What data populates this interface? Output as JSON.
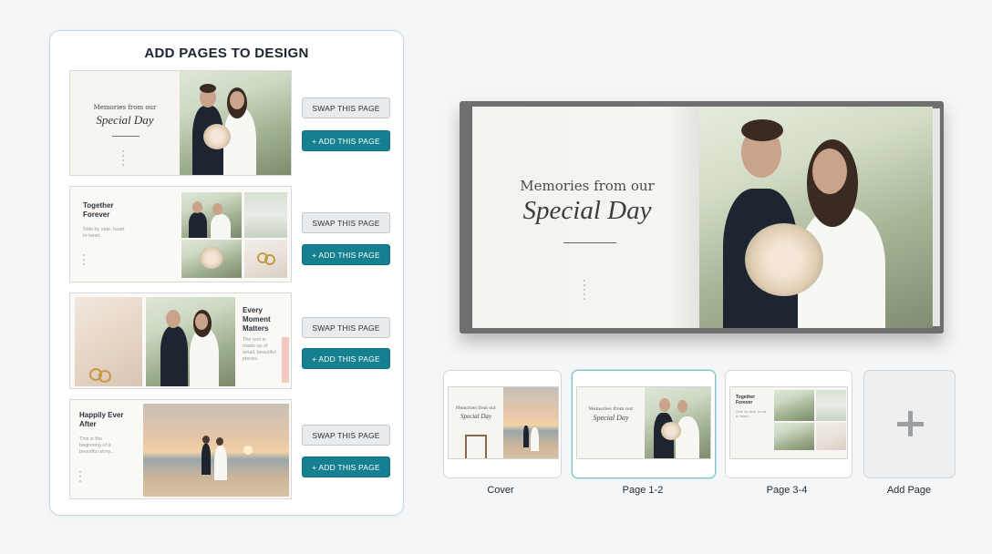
{
  "panel": {
    "title": "ADD PAGES TO DESIGN",
    "templates": [
      {
        "small_text": "Memories from our",
        "big_text": "Special Day",
        "swap_label": "SWAP THIS PAGE",
        "add_label": "+ ADD THIS PAGE"
      },
      {
        "heading": "Together Forever",
        "body": "Side by side, heart to heart.",
        "swap_label": "SWAP THIS PAGE",
        "add_label": "+ ADD THIS PAGE"
      },
      {
        "heading": "Every Moment Matters",
        "body": "The rest is made up of small, beautiful pieces.",
        "swap_label": "SWAP THIS PAGE",
        "add_label": "+ ADD THIS PAGE"
      },
      {
        "heading": "Happily Ever After",
        "body": "This is the beginning of a beautiful story...",
        "swap_label": "SWAP THIS PAGE",
        "add_label": "+ ADD THIS PAGE"
      }
    ]
  },
  "book": {
    "small_text": "Memories from our",
    "big_text": "Special Day"
  },
  "thumbnails": [
    {
      "label": "Cover",
      "small_text": "Memories from our",
      "big_text": "Special Day"
    },
    {
      "label": "Page 1-2",
      "small_text": "Memories from our",
      "big_text": "Special Day",
      "selected": true
    },
    {
      "label": "Page 3-4",
      "heading": "Together Forever",
      "body": "Side by side, heart to heart."
    },
    {
      "label": "Add Page"
    }
  ],
  "colors": {
    "accent": "#15808f",
    "panel_border": "#b9dde3",
    "swap_button": "#e9ecee"
  },
  "icons": {
    "add_page": "plus-icon"
  }
}
